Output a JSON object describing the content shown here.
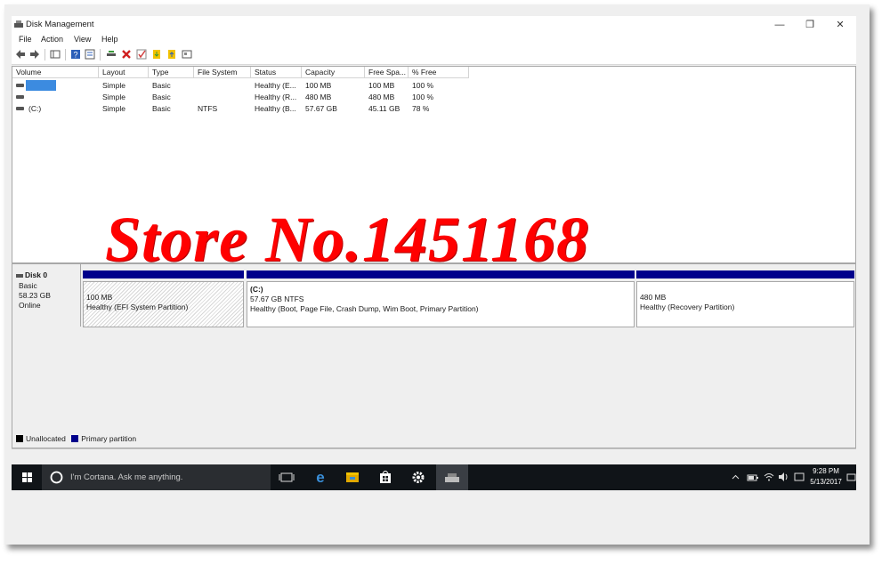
{
  "window": {
    "title": "Disk Management",
    "controls": [
      "—",
      "❐",
      "✕"
    ]
  },
  "menu": [
    "File",
    "Action",
    "View",
    "Help"
  ],
  "toolbar_icons": [
    "back-arrow-icon",
    "forward-arrow-icon",
    "console-tree-icon",
    "help-icon",
    "properties-icon",
    "connect-icon",
    "delete-icon",
    "check-icon",
    "import-icon",
    "export-icon",
    "settings-icon"
  ],
  "volume_table": {
    "headers": [
      "Volume",
      "Layout",
      "Type",
      "File System",
      "Status",
      "Capacity",
      "Free Spa...",
      "% Free"
    ],
    "rows": [
      {
        "volume": "",
        "layout": "Simple",
        "type": "Basic",
        "fs": "",
        "status": "Healthy (E...",
        "capacity": "100 MB",
        "free": "100 MB",
        "pct": "100 %"
      },
      {
        "volume": "",
        "layout": "Simple",
        "type": "Basic",
        "fs": "",
        "status": "Healthy (R...",
        "capacity": "480 MB",
        "free": "480 MB",
        "pct": "100 %"
      },
      {
        "volume": "(C:)",
        "layout": "Simple",
        "type": "Basic",
        "fs": "NTFS",
        "status": "Healthy (B...",
        "capacity": "57.67 GB",
        "free": "45.11 GB",
        "pct": "78 %"
      }
    ]
  },
  "watermark": "Store No.1451168",
  "disk": {
    "name": "Disk 0",
    "type": "Basic",
    "size": "58.23 GB",
    "state": "Online",
    "partitions": [
      {
        "name": "",
        "size": "100 MB",
        "status": "Healthy (EFI System Partition)"
      },
      {
        "name": "(C:)",
        "size": "57.67 GB NTFS",
        "status": "Healthy (Boot, Page File, Crash Dump, Wim Boot, Primary Partition)"
      },
      {
        "name": "",
        "size": "480 MB",
        "status": "Healthy (Recovery Partition)"
      }
    ]
  },
  "legend": {
    "unallocated": "Unallocated",
    "primary": "Primary partition",
    "unallocated_color": "#000000",
    "primary_color": "#00008b"
  },
  "taskbar": {
    "search_placeholder": "I'm Cortana. Ask me anything.",
    "time": "9:28 PM",
    "date": "5/13/2017"
  }
}
